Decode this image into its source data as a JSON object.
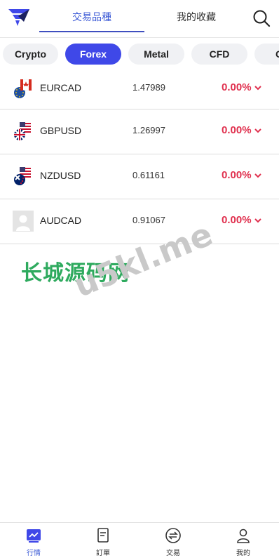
{
  "header": {
    "tabs": [
      "交易品種",
      "我的收藏"
    ],
    "active_tab": 0
  },
  "categories": {
    "items": [
      "Crypto",
      "Forex",
      "Metal",
      "CFD",
      "C"
    ],
    "active": "Forex"
  },
  "quotes": [
    {
      "symbol": "EURCAD",
      "price": "1.47989",
      "change": "0.00%"
    },
    {
      "symbol": "GBPUSD",
      "price": "1.26997",
      "change": "0.00%"
    },
    {
      "symbol": "NZDUSD",
      "price": "0.61161",
      "change": "0.00%"
    },
    {
      "symbol": "AUDCAD",
      "price": "0.91067",
      "change": "0.00%"
    }
  ],
  "watermark": {
    "cn": "长城源码网",
    "en": "u5kl.me"
  },
  "bottom_nav": {
    "items": [
      "行情",
      "訂單",
      "交易",
      "我的"
    ],
    "active": "行情"
  },
  "colors": {
    "accent": "#3f48e8",
    "change_red": "#e0304e",
    "tab_active": "#3d5bd6"
  }
}
